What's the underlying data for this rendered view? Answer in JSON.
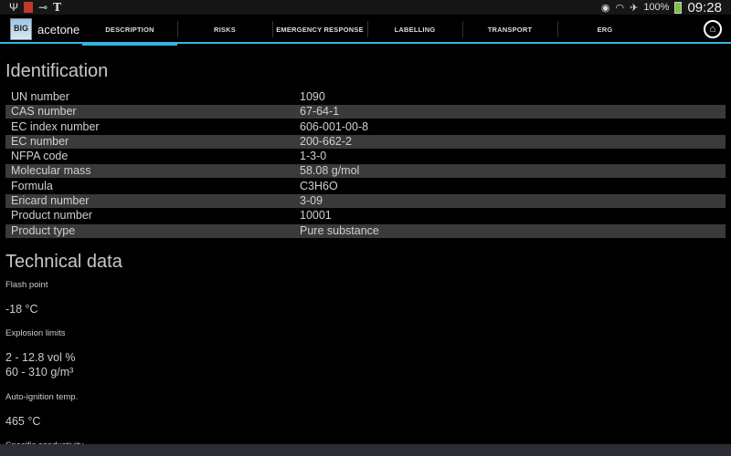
{
  "status_bar": {
    "icons": [
      "usb-icon",
      "app-notification-icon",
      "key-icon",
      "nyt-icon"
    ],
    "right_icons": [
      "eye-icon",
      "wifi-icon",
      "airplane-icon"
    ],
    "battery": "100%",
    "time": "09:28"
  },
  "app": {
    "title": "acetone",
    "logo_text": "BIG"
  },
  "tabs": [
    {
      "label": "DESCRIPTION",
      "selected": true
    },
    {
      "label": "RISKS"
    },
    {
      "label": "EMERGENCY RESPONSE"
    },
    {
      "label": "LABELLING"
    },
    {
      "label": "TRANSPORT"
    },
    {
      "label": "ERG"
    }
  ],
  "identification": {
    "heading": "Identification",
    "rows": [
      {
        "k": "UN number",
        "v": "1090"
      },
      {
        "k": "CAS number",
        "v": "67-64-1"
      },
      {
        "k": "EC index number",
        "v": "606-001-00-8"
      },
      {
        "k": "EC number",
        "v": "200-662-2"
      },
      {
        "k": "NFPA code",
        "v": "1-3-0"
      },
      {
        "k": "Molecular mass",
        "v": "58.08 g/mol"
      },
      {
        "k": "Formula",
        "v": "C3H6O"
      },
      {
        "k": "Ericard number",
        "v": "3-09"
      },
      {
        "k": "Product number",
        "v": "10001"
      },
      {
        "k": "Product type",
        "v": "Pure substance"
      }
    ]
  },
  "technical": {
    "heading": "Technical data",
    "flash_point": {
      "label": "Flash point",
      "value": "-18 °C"
    },
    "explosion_limits": {
      "label": "Explosion limits",
      "value1": "2 - 12.8 vol %",
      "value2": "60 - 310 g/m³"
    },
    "auto_ignition": {
      "label": "Auto-ignition temp.",
      "value": "465 °C"
    },
    "conductivity": {
      "label": "Specific conductivity"
    }
  }
}
